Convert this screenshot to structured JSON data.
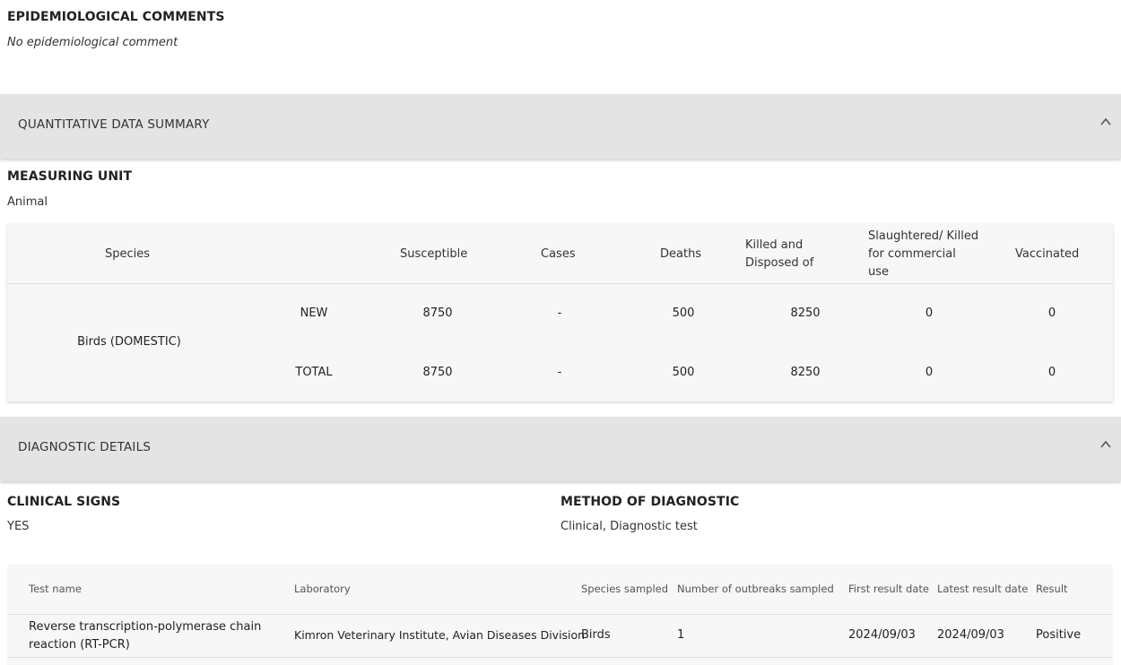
{
  "epidemiological": {
    "title": "EPIDEMIOLOGICAL COMMENTS",
    "text": "No epidemiological comment"
  },
  "quantitative": {
    "bar_label": "QUANTITATIVE DATA SUMMARY",
    "measuring_unit_title": "MEASURING UNIT",
    "measuring_unit_value": "Animal",
    "headers": {
      "species": "Species",
      "susceptible": "Susceptible",
      "cases": "Cases",
      "deaths": "Deaths",
      "killed_line1": "Killed and",
      "killed_line2": "Disposed of",
      "slaughtered_line1": "Slaughtered/ Killed",
      "slaughtered_line2": "for commercial",
      "slaughtered_line3": "use",
      "vaccinated": "Vaccinated"
    },
    "species_name": "Birds (DOMESTIC)",
    "rows": [
      {
        "label": "NEW",
        "susceptible": "8750",
        "cases": "-",
        "deaths": "500",
        "killed": "8250",
        "slaughtered": "0",
        "vaccinated": "0"
      },
      {
        "label": "TOTAL",
        "susceptible": "8750",
        "cases": "-",
        "deaths": "500",
        "killed": "8250",
        "slaughtered": "0",
        "vaccinated": "0"
      }
    ]
  },
  "diagnostic": {
    "bar_label": "DIAGNOSTIC DETAILS",
    "clinical_signs_title": "CLINICAL SIGNS",
    "clinical_signs_value": "YES",
    "method_title": "METHOD OF DIAGNOSTIC",
    "method_value": "Clinical, Diagnostic test",
    "headers": {
      "test_name": "Test name",
      "laboratory": "Laboratory",
      "species_sampled": "Species sampled",
      "outbreaks_sampled": "Number of outbreaks sampled",
      "first_result": "First result date",
      "latest_result": "Latest result date",
      "result": "Result"
    },
    "row": {
      "test_name_line1": "Reverse transcription-polymerase chain",
      "test_name_line2": "reaction (RT-PCR)",
      "laboratory": "Kimron Veterinary Institute, Avian Diseases Division",
      "species_sampled": "Birds",
      "outbreaks_sampled": "1",
      "first_result": "2024/09/03",
      "latest_result": "2024/09/03",
      "result": "Positive"
    }
  },
  "icons": {
    "collapse": "chevron-up-icon"
  }
}
